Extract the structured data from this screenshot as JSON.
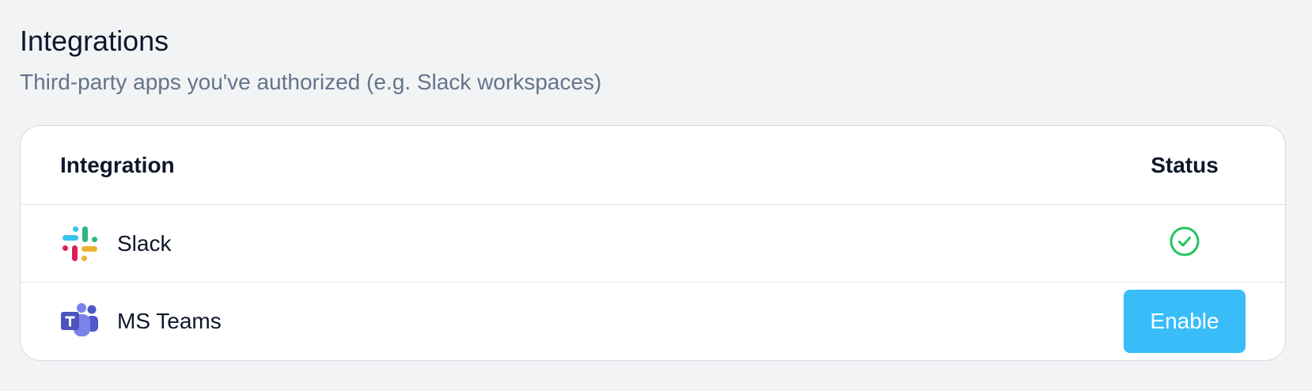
{
  "section": {
    "title": "Integrations",
    "subtitle": "Third-party apps you've authorized (e.g. Slack workspaces)"
  },
  "table": {
    "headers": {
      "name": "Integration",
      "status": "Status"
    },
    "rows": [
      {
        "name": "Slack",
        "icon": "slack-icon",
        "status": "enabled",
        "status_icon": "check-circle-icon"
      },
      {
        "name": "MS Teams",
        "icon": "ms-teams-icon",
        "status": "disabled",
        "action_label": "Enable"
      }
    ]
  },
  "colors": {
    "enabled_check": "#22c55e",
    "enable_button": "#38bdf8",
    "subtitle_text": "#64748b"
  }
}
